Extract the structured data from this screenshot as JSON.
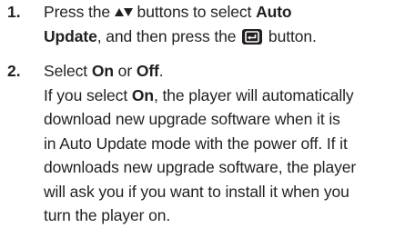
{
  "steps": [
    {
      "number": "1.",
      "lines": [
        {
          "prefix": "Press the ",
          "icons": [
            "up-arrow-icon",
            "down-arrow-icon"
          ],
          "middle": " buttons to select ",
          "bold": "Auto"
        },
        {
          "bold": "Update",
          "middle": ", and then press the ",
          "icon": "enter-button-icon",
          "suffix": " button."
        }
      ]
    },
    {
      "number": "2.",
      "select_line": {
        "prefix": "Select ",
        "option_on": "On",
        "connector": " or ",
        "option_off": "Off",
        "suffix": "."
      },
      "detail_lines": {
        "line1_prefix": "If you select ",
        "line1_bold": "On",
        "line1_suffix": ", the player will automatically",
        "line2": "download new upgrade software when it is",
        "line3": "in Auto Update mode with the power off. If it",
        "line4": "downloads new upgrade software, the player",
        "line5": "will ask you if you want to install it when you",
        "line6": "turn the player on."
      }
    }
  ],
  "colors": {
    "text": "#231f20",
    "icon_fill": "#231f20",
    "icon_symbol": "#ffffff"
  }
}
